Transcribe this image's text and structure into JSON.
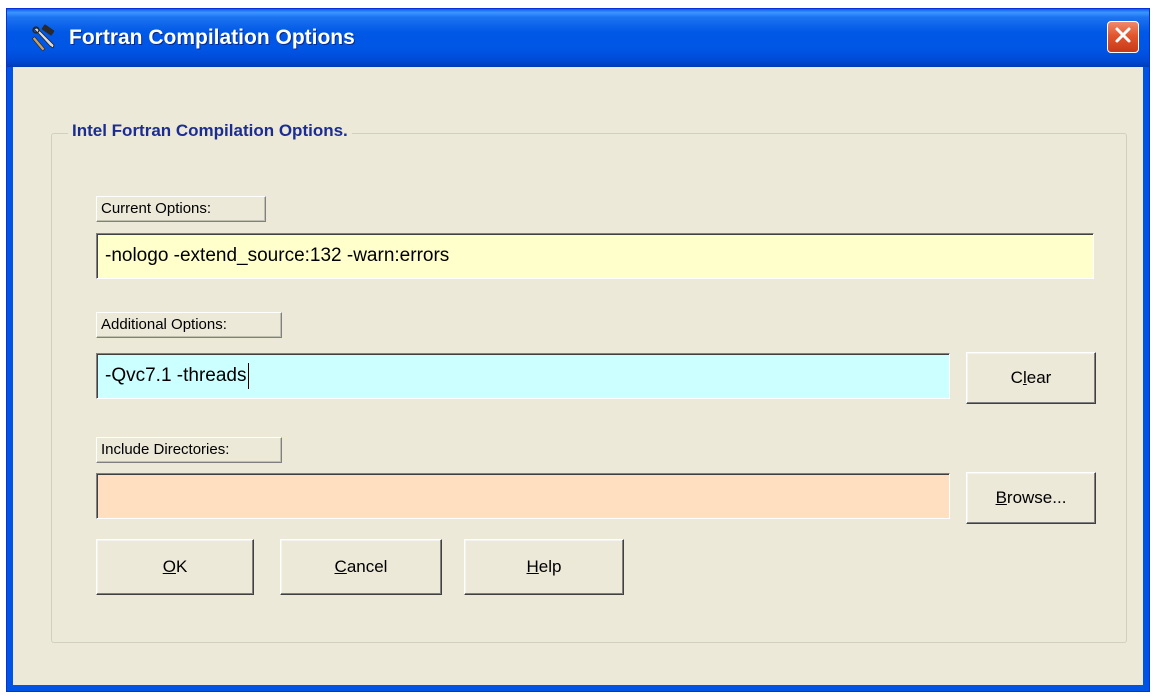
{
  "window": {
    "title": "Fortran Compilation Options",
    "icon": "tools-icon",
    "close_icon": "close-icon",
    "titlebar_color": "#0054e3",
    "close_color": "#e2562e"
  },
  "group": {
    "title": "Intel Fortran Compilation Options."
  },
  "current_options": {
    "label": "Current Options:",
    "value": "-nologo -extend_source:132 -warn:errors",
    "bg_color": "#ffffcc"
  },
  "additional_options": {
    "label": "Additional Options:",
    "value": "-Qvc7.1 -threads",
    "bg_color": "#ccffff",
    "clear_button": {
      "pre": "C",
      "mnemonic": "l",
      "post": "ear"
    }
  },
  "include_directories": {
    "label": "Include Directories:",
    "value": "",
    "bg_color": "#ffdfc0",
    "browse_button": {
      "pre": "",
      "mnemonic": "B",
      "post": "rowse..."
    }
  },
  "buttons": {
    "ok": {
      "pre": "",
      "mnemonic": "O",
      "post": "K"
    },
    "cancel": {
      "pre": "",
      "mnemonic": "C",
      "post": "ancel"
    },
    "help": {
      "pre": "",
      "mnemonic": "H",
      "post": "elp"
    }
  }
}
